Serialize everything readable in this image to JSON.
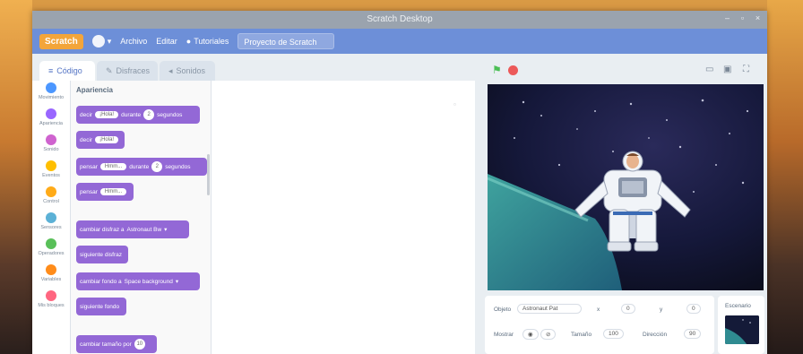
{
  "window": {
    "title": "Scratch Desktop"
  },
  "menubar": {
    "logo": "Scratch",
    "settings_label": "",
    "file_label": "Archivo",
    "edit_label": "Editar",
    "tutorials_label": "Tutoriales",
    "project_name": "Proyecto de Scratch"
  },
  "tabs": [
    {
      "label": "Código"
    },
    {
      "label": "Disfraces"
    },
    {
      "label": "Sonidos"
    }
  ],
  "categories": [
    {
      "label": "Movimiento",
      "color": "#4c97ff"
    },
    {
      "label": "Apariencia",
      "color": "#9966ff"
    },
    {
      "label": "Sonido",
      "color": "#cf63cf"
    },
    {
      "label": "Eventos",
      "color": "#ffbf00"
    },
    {
      "label": "Control",
      "color": "#ffab19"
    },
    {
      "label": "Sensores",
      "color": "#5cb1d6"
    },
    {
      "label": "Operadores",
      "color": "#59c059"
    },
    {
      "label": "Variables",
      "color": "#ff8c1a"
    },
    {
      "label": "Mis bloques",
      "color": "#ff6680"
    }
  ],
  "palette": {
    "title": "Apariencia",
    "blocks": [
      {
        "parts": [
          "decir",
          "¡Hola!",
          "durante",
          "2",
          "segundos"
        ]
      },
      {
        "parts": [
          "decir",
          "¡Hola!"
        ]
      },
      {
        "parts": [
          "pensar",
          "Hmm...",
          "durante",
          "2",
          "segundos"
        ]
      },
      {
        "parts": [
          "pensar",
          "Hmm..."
        ]
      },
      {
        "parts": [
          "cambiar disfraz a",
          "Astronaut Bw",
          "▾"
        ]
      },
      {
        "parts": [
          "siguiente disfraz"
        ]
      },
      {
        "parts": [
          "cambiar fondo a",
          "Space background",
          "▾"
        ]
      },
      {
        "parts": [
          "siguiente fondo"
        ]
      },
      {
        "parts": [
          "cambiar tamaño por",
          "10"
        ]
      }
    ]
  },
  "sprite_info": {
    "sprite_label": "Objeto",
    "sprite_name": "Astronaut Pat",
    "x_label": "x",
    "x_value": "0",
    "y_label": "y",
    "y_value": "0",
    "show_label": "Mostrar",
    "size_label": "Tamaño",
    "size_value": "100",
    "direction_label": "Dirección",
    "direction_value": "90"
  },
  "stage_panel": {
    "label": "Escenario"
  }
}
